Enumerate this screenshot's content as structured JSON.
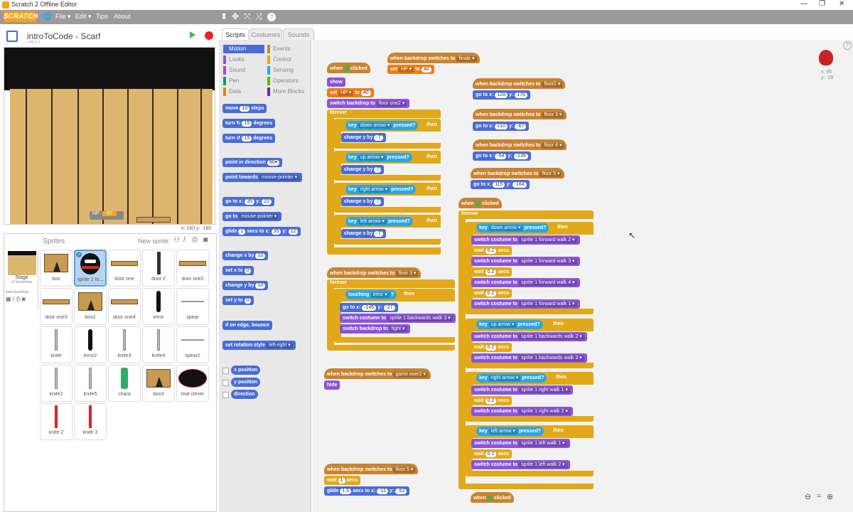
{
  "window": {
    "title": "Scratch 2 Offline Editor",
    "minimize": "—",
    "restore": "❐",
    "close": "✕"
  },
  "menu": {
    "logo": "SCRATCH",
    "items": [
      "File ▾",
      "Edit ▾",
      "Tips",
      "About"
    ],
    "globe": "🌐"
  },
  "toolbar": {
    "icons": [
      "stamp-icon",
      "grow-icon",
      "shrink-icon",
      "fullscreen-icon",
      "help-icon"
    ],
    "glyphs": [
      "⬍",
      "✥",
      "⤧",
      "⤨",
      "?"
    ]
  },
  "stage": {
    "project_title": "introToCode - Scarf",
    "version": "v402.0.1",
    "hp_label": "HP",
    "hp_value": "40",
    "coords": "x: 240  y: -180"
  },
  "sprites_pane": {
    "title": "Sprites",
    "new_sprite": "New sprite:",
    "stage_label": "Stage",
    "stage_sub": "12 backdrops",
    "new_backdrop": "New backdrop:",
    "sprites": [
      {
        "name": "box",
        "kind": "box"
      },
      {
        "name": "sprite 1 fo...",
        "kind": "ninja",
        "selected": true
      },
      {
        "name": "door one",
        "kind": "plank"
      },
      {
        "name": "door 2",
        "kind": "door"
      },
      {
        "name": "door one2",
        "kind": "plank"
      },
      {
        "name": "door one3",
        "kind": "plank"
      },
      {
        "name": "box2",
        "kind": "box"
      },
      {
        "name": "door one4",
        "kind": "plank"
      },
      {
        "name": "error",
        "kind": "stick"
      },
      {
        "name": "spear",
        "kind": "spear"
      },
      {
        "name": "knife",
        "kind": "knife"
      },
      {
        "name": "error2",
        "kind": "stick"
      },
      {
        "name": "knife3",
        "kind": "knife"
      },
      {
        "name": "knife4",
        "kind": "knife"
      },
      {
        "name": "spear2",
        "kind": "spear"
      },
      {
        "name": "knife2",
        "kind": "knife"
      },
      {
        "name": "knife5",
        "kind": "knife"
      },
      {
        "name": "chara",
        "kind": "chara"
      },
      {
        "name": "box3",
        "kind": "box"
      },
      {
        "name": "real clever",
        "kind": "oval"
      },
      {
        "name": "knife 2",
        "kind": "redknife"
      },
      {
        "name": "knife 3",
        "kind": "redknife"
      }
    ]
  },
  "tabs": {
    "scripts": "Scripts",
    "costumes": "Costumes",
    "sounds": "Sounds"
  },
  "categories": {
    "left": [
      "Motion",
      "Looks",
      "Sound",
      "Pen",
      "Data"
    ],
    "right": [
      "Events",
      "Control",
      "Sensing",
      "Operators",
      "More Blocks"
    ]
  },
  "palette": {
    "move": "move",
    "move_n": "10",
    "steps": "steps",
    "turn_r": "turn ↻",
    "turn_r_n": "15",
    "turn_l": "turn ↺",
    "turn_l_n": "15",
    "degrees": "degrees",
    "point_dir": "point in direction",
    "point_dir_v": "90▾",
    "point_towards": "point towards",
    "mouse_pointer": "mouse-pointer ▾",
    "goto": "go to x:",
    "goto_x": "35",
    "y": "y:",
    "goto_y": "22",
    "goto_mp": "go to",
    "glide": "glide",
    "glide_n": "1",
    "glide_txt": "secs to x:",
    "glide_x": "35",
    "glide_y": "22",
    "change_x": "change x by",
    "change_x_n": "10",
    "set_x": "set x to",
    "set_x_n": "0",
    "change_y": "change y by",
    "change_y_n": "10",
    "set_y": "set y to",
    "set_y_n": "0",
    "edge": "if on edge, bounce",
    "rot": "set rotation style",
    "rot_v": "left-right ▾",
    "xpos": "x position",
    "ypos": "y position",
    "dir": "direction"
  },
  "scripts": {
    "s1": {
      "when": "when",
      "clicked": "clicked",
      "show": "show",
      "set": "set",
      "hp": "HP ▾",
      "to": "to",
      "hp_val": "40",
      "switch_bd": "switch backdrop to",
      "floor_one": "floor one2 ▾",
      "forever": "forever",
      "if": "if",
      "then": "then",
      "key": "key",
      "down": "down arrow ▾",
      "up": "up arrow ▾",
      "right": "right arrow ▾",
      "left": "left arrow ▾",
      "pressed": "pressed?",
      "chg_y": "change y by",
      "chg_x": "change x by",
      "n7": "-7",
      "n7b": "7",
      "n7c": "7",
      "n7d": "-7"
    },
    "s2": {
      "when_bd": "when backdrop switches to",
      "finale": "finale ▾",
      "set": "set",
      "hp": "HP ▾",
      "to": "to",
      "val": "40"
    },
    "s3": [
      {
        "floor": "floor2 ▾",
        "x": "128",
        "y": "176"
      },
      {
        "floor": "floor 3 ▾",
        "x": "210",
        "y": "-67"
      },
      {
        "floor": "floor 4 ▾",
        "x": "-54",
        "y": "-139"
      },
      {
        "floor": "floor 5 ▾",
        "x": "115",
        "y": "-164"
      }
    ],
    "goto": "go to x:",
    "y": "y:",
    "s4": {
      "floor": "floor 3 ▾",
      "forever": "forever",
      "touching": "touching",
      "err": "error ▾",
      "q": "?",
      "goto_x": "-145",
      "goto_y": "-27",
      "costume": "switch costume to",
      "cost_v": "sprite 1 backwards walk 3 ▾",
      "bd": "switch backdrop to",
      "bd_v": "fight ▾"
    },
    "s5": {
      "when_bd": "when backdrop switches to",
      "val": "game over2 ▾",
      "hide": "hide"
    },
    "s6": {
      "floor": "floor 5 ▾",
      "wait": "wait",
      "wait_n": "1",
      "secs": "secs",
      "glide": "glide",
      "glide_n": "1.5",
      "secs_to": "secs to x:",
      "gx": "-11",
      "gy": "-52"
    },
    "s7": {
      "down": "down arrow ▾",
      "up": "up arrow ▾",
      "right": "right arrow ▾",
      "left": "left arrow ▾",
      "fw": [
        "sprite 1 forward walk 2 ▾",
        "sprite 1 forward walk 3 ▾",
        "sprite 1 forward walk 4 ▾",
        "sprite 1 forward walk 1 ▾"
      ],
      "bw": [
        "sprite 1 backwards walk 2 ▾",
        "sprite 1 backwards walk 3 ▾"
      ],
      "rw": [
        "sprite 1 right walk 1 ▾",
        "sprite 1 right walk 2 ▾"
      ],
      "lw": [
        "sprite 1 left walk 1 ▾",
        "sprite 1 left walk 2 ▾"
      ],
      "wait": "wait",
      "w": "0.2",
      "secs": "secs"
    },
    "coords": {
      "x": "x: 95",
      "y": "y: -28"
    }
  },
  "zoom": {
    "out": "🔍−",
    "reset": "=",
    "in": "🔍+"
  }
}
